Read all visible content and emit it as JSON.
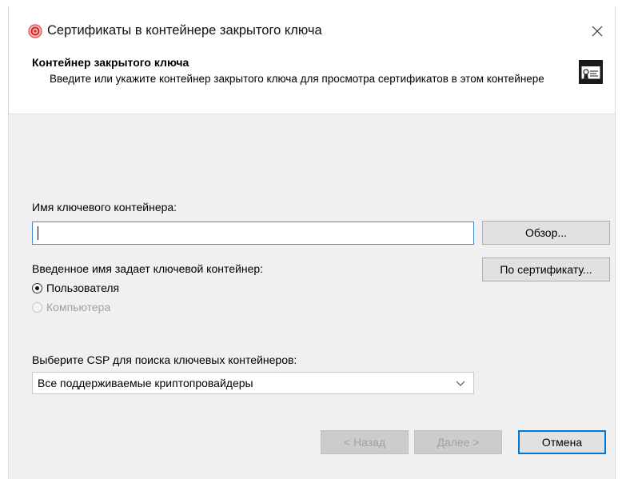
{
  "window": {
    "title": "Сертификаты в контейнере закрытого ключа"
  },
  "header": {
    "title": "Контейнер закрытого ключа",
    "description": "Введите или укажите контейнер закрытого ключа для просмотра сертификатов в этом контейнере"
  },
  "container_name": {
    "label": "Имя ключевого контейнера:",
    "value": "",
    "browse_label": "Обзор..."
  },
  "entered_name": {
    "label": "Введенное имя задает ключевой контейнер:",
    "by_certificate_label": "По сертификату...",
    "options": [
      {
        "label": "Пользователя",
        "selected": true,
        "enabled": true
      },
      {
        "label": "Компьютера",
        "selected": false,
        "enabled": false
      }
    ]
  },
  "csp": {
    "label": "Выберите CSP для поиска ключевых контейнеров:",
    "selected": "Все поддерживаемые криптопровайдеры"
  },
  "footer": {
    "back_label": "< Назад",
    "next_label": "Далее >",
    "cancel_label": "Отмена"
  },
  "colors": {
    "dialog_bg": "#f0f0f0",
    "focus_border": "#0078d7",
    "app_icon": "#e23c3c"
  }
}
